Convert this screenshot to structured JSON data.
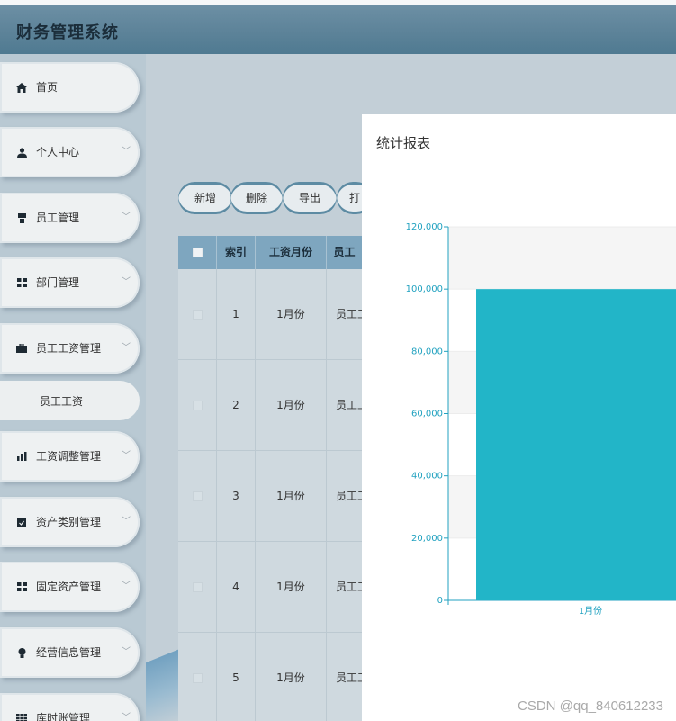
{
  "app": {
    "title": "财务管理系统"
  },
  "sidebar": {
    "items": [
      {
        "label": "首页",
        "icon": "home-icon",
        "has_chevron": false
      },
      {
        "label": "个人中心",
        "icon": "user-icon",
        "has_chevron": true
      },
      {
        "label": "员工管理",
        "icon": "id-badge-icon",
        "has_chevron": true
      },
      {
        "label": "部门管理",
        "icon": "grid-icon",
        "has_chevron": true
      },
      {
        "label": "员工工资管理",
        "icon": "briefcase-icon",
        "has_chevron": true
      },
      {
        "label": "员工工资",
        "icon": "",
        "has_chevron": false,
        "submenu": true
      },
      {
        "label": "工资调整管理",
        "icon": "bar-chart-icon",
        "has_chevron": true
      },
      {
        "label": "资产类别管理",
        "icon": "clipboard-icon",
        "has_chevron": true
      },
      {
        "label": "固定资产管理",
        "icon": "grid-icon",
        "has_chevron": true
      },
      {
        "label": "经营信息管理",
        "icon": "bulb-icon",
        "has_chevron": true
      },
      {
        "label": "库时账管理",
        "icon": "table-icon",
        "has_chevron": true
      }
    ]
  },
  "toolbar": {
    "buttons": [
      "新增",
      "删除",
      "导出",
      "打"
    ]
  },
  "table": {
    "headers": [
      "",
      "索引",
      "工资月份",
      "员工"
    ],
    "rows": [
      {
        "index": "1",
        "month": "1月份",
        "employee": "员工工"
      },
      {
        "index": "2",
        "month": "1月份",
        "employee": "员工工"
      },
      {
        "index": "3",
        "month": "1月份",
        "employee": "员工工"
      },
      {
        "index": "4",
        "month": "1月份",
        "employee": "员工工"
      },
      {
        "index": "5",
        "month": "1月份",
        "employee": "员工工"
      }
    ]
  },
  "dialog": {
    "title": "统计报表"
  },
  "chart_data": {
    "type": "bar",
    "categories": [
      "1月份"
    ],
    "values": [
      100000
    ],
    "ylim": [
      0,
      120000
    ],
    "yticks": [
      0,
      20000,
      40000,
      60000,
      80000,
      100000,
      120000
    ],
    "ytick_labels": [
      "0",
      "20,000",
      "40,000",
      "60,000",
      "80,000",
      "100,000",
      "120,000"
    ],
    "bar_color": "#22b5c8",
    "axis_color": "#22a2c0",
    "grid": true
  },
  "watermark": "CSDN @qq_840612233",
  "colors": {
    "header": "#5d8399",
    "accent": "#22b5c8"
  }
}
